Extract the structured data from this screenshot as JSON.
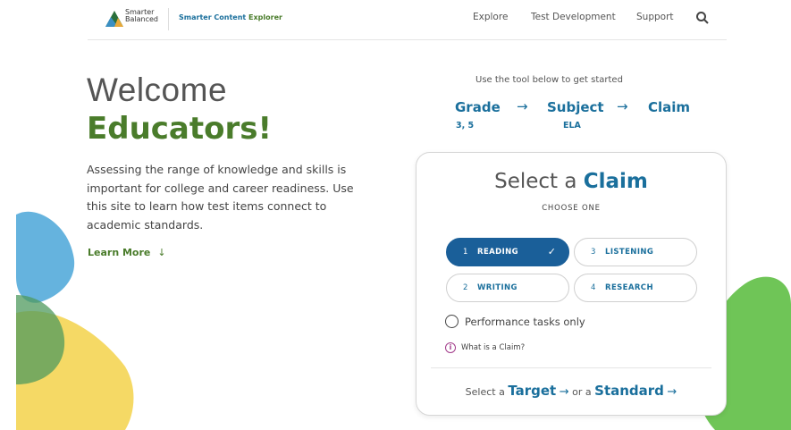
{
  "header": {
    "logo_line1": "Smarter",
    "logo_line2": "Balanced",
    "app_name_1": "Smarter Content ",
    "app_name_2": "Explorer",
    "nav": [
      "Explore",
      "Test Development",
      "Support"
    ]
  },
  "hero": {
    "welcome": "Welcome",
    "educators": "Educators!",
    "intro": "Assessing the range of knowledge and skills is important for college and career readiness. Use this site to learn how test items connect to academic standards.",
    "learn_more": "Learn More"
  },
  "steps": {
    "hint": "Use the tool below to get started",
    "grade": {
      "label": "Grade",
      "value": "3, 5"
    },
    "subject": {
      "label": "Subject",
      "value": "ELA"
    },
    "claim": {
      "label": "Claim"
    }
  },
  "card": {
    "title_pre": "Select a ",
    "title_strong": "Claim",
    "subtitle": "CHOOSE ONE",
    "options": [
      {
        "num": "1",
        "label": "READING",
        "selected": true
      },
      {
        "num": "3",
        "label": "LISTENING",
        "selected": false
      },
      {
        "num": "2",
        "label": "WRITING",
        "selected": false
      },
      {
        "num": "4",
        "label": "RESEARCH",
        "selected": false
      }
    ],
    "performance_only": "Performance tasks only",
    "info_link": "What is a Claim?",
    "bottom_pre": "Select a ",
    "target": "Target",
    "or": "or a",
    "standard": "Standard"
  },
  "colors": {
    "brand_blue": "#1a6f9c",
    "selected_blue": "#1a5f99",
    "brand_green": "#4a7c2b"
  },
  "icons": {
    "search": "search-icon",
    "learn_more_arrow": "arrow-down-icon",
    "step_arrow": "arrow-right-icon",
    "check": "check-icon",
    "info": "info-icon"
  }
}
